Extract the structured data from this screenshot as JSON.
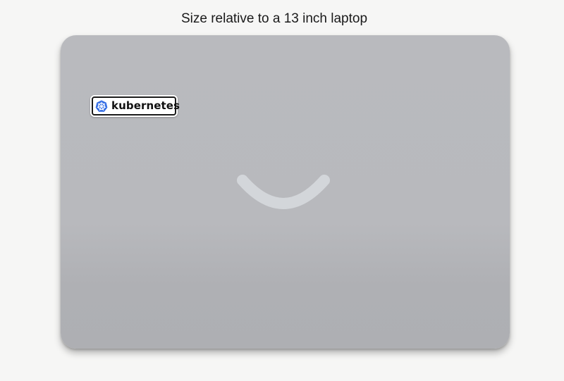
{
  "caption": "Size relative to a 13 inch laptop",
  "sticker": {
    "brand_text": "kubernetes",
    "icon": "kubernetes-helm-wheel-icon",
    "icon_color": "#326ce5"
  },
  "laptop": {
    "icon": "laptop-logo-smile-icon",
    "body_color": "#b9babe",
    "logo_color": "#d3d6da"
  }
}
